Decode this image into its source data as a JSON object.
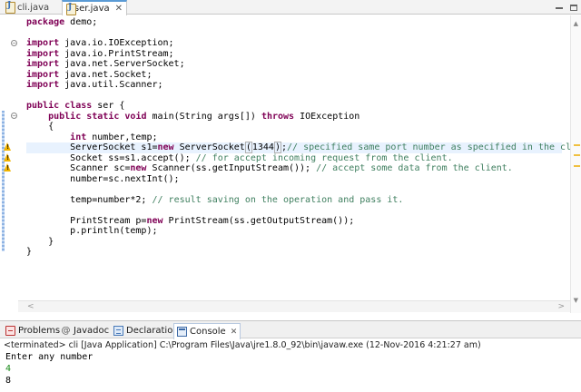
{
  "editor_tabs": [
    {
      "label": "cli.java",
      "active": false
    },
    {
      "label": "ser.java",
      "active": true
    }
  ],
  "code_lines": [
    {
      "tokens": [
        {
          "t": "package",
          "c": "kw"
        },
        {
          "t": " demo;",
          "c": ""
        }
      ]
    },
    {
      "tokens": []
    },
    {
      "tokens": [
        {
          "t": "import",
          "c": "kw"
        },
        {
          "t": " java.io.IOException;",
          "c": ""
        }
      ]
    },
    {
      "tokens": [
        {
          "t": "import",
          "c": "kw"
        },
        {
          "t": " java.io.PrintStream;",
          "c": ""
        }
      ]
    },
    {
      "tokens": [
        {
          "t": "import",
          "c": "kw"
        },
        {
          "t": " java.net.ServerSocket;",
          "c": ""
        }
      ]
    },
    {
      "tokens": [
        {
          "t": "import",
          "c": "kw"
        },
        {
          "t": " java.net.Socket;",
          "c": ""
        }
      ]
    },
    {
      "tokens": [
        {
          "t": "import",
          "c": "kw"
        },
        {
          "t": " java.util.Scanner;",
          "c": ""
        }
      ]
    },
    {
      "tokens": []
    },
    {
      "tokens": [
        {
          "t": "public",
          "c": "kw"
        },
        {
          "t": " ",
          "c": ""
        },
        {
          "t": "class",
          "c": "kw"
        },
        {
          "t": " ser {",
          "c": ""
        }
      ]
    },
    {
      "tokens": [
        {
          "t": "    ",
          "c": ""
        },
        {
          "t": "public",
          "c": "kw"
        },
        {
          "t": " ",
          "c": ""
        },
        {
          "t": "static",
          "c": "kw"
        },
        {
          "t": " ",
          "c": ""
        },
        {
          "t": "void",
          "c": "kw"
        },
        {
          "t": " main(String args[]) ",
          "c": ""
        },
        {
          "t": "throws",
          "c": "kw"
        },
        {
          "t": " IOException",
          "c": ""
        }
      ]
    },
    {
      "tokens": [
        {
          "t": "    {",
          "c": ""
        }
      ]
    },
    {
      "tokens": [
        {
          "t": "        ",
          "c": ""
        },
        {
          "t": "int",
          "c": "kw"
        },
        {
          "t": " number,temp;",
          "c": ""
        }
      ]
    },
    {
      "tokens": [
        {
          "t": "        ServerSocket s1=",
          "c": ""
        },
        {
          "t": "new",
          "c": "kw"
        },
        {
          "t": " ServerSocket",
          "c": ""
        },
        {
          "t": "(",
          "c": "bm"
        },
        {
          "t": "1344",
          "c": ""
        },
        {
          "t": ")",
          "c": "bm"
        },
        {
          "t": ";",
          "c": ""
        },
        {
          "t": "// specified same port number as specified in the client",
          "c": "cm"
        }
      ],
      "highlight": true
    },
    {
      "tokens": [
        {
          "t": "        Socket ss=s1.accept(); ",
          "c": ""
        },
        {
          "t": "// for accept incoming request from the client.",
          "c": "cm"
        }
      ]
    },
    {
      "tokens": [
        {
          "t": "        Scanner sc=",
          "c": ""
        },
        {
          "t": "new",
          "c": "kw"
        },
        {
          "t": " Scanner(ss.getInputStream()); ",
          "c": ""
        },
        {
          "t": "// accept some data from the client.",
          "c": "cm"
        }
      ]
    },
    {
      "tokens": [
        {
          "t": "        number=sc.nextInt();",
          "c": ""
        }
      ]
    },
    {
      "tokens": []
    },
    {
      "tokens": [
        {
          "t": "        temp=number*2; ",
          "c": ""
        },
        {
          "t": "// result saving on the operation and pass it.",
          "c": "cm"
        }
      ]
    },
    {
      "tokens": []
    },
    {
      "tokens": [
        {
          "t": "        PrintStream p=",
          "c": ""
        },
        {
          "t": "new",
          "c": "kw"
        },
        {
          "t": " PrintStream(ss.getOutputStream());",
          "c": ""
        }
      ]
    },
    {
      "tokens": [
        {
          "t": "        p.println(temp);",
          "c": ""
        }
      ]
    },
    {
      "tokens": [
        {
          "t": "    }",
          "c": ""
        }
      ]
    },
    {
      "tokens": [
        {
          "t": "}",
          "c": ""
        }
      ]
    }
  ],
  "view_tabs": [
    {
      "label": "Problems",
      "icon": "problems-icon",
      "active": false
    },
    {
      "label": "Javadoc",
      "icon": "javadoc-icon",
      "active": false
    },
    {
      "label": "Declaration",
      "icon": "declaration-icon",
      "active": false
    },
    {
      "label": "Console",
      "icon": "console-icon",
      "active": true
    }
  ],
  "console": {
    "terminated_text": "<terminated> cli [Java Application] C:\\Program Files\\Java\\jre1.8.0_92\\bin\\javaw.exe (12-Nov-2016 4:21:27 am)",
    "lines": [
      {
        "text": "Enter any number",
        "kind": "output"
      },
      {
        "text": "4",
        "kind": "input"
      },
      {
        "text": "8",
        "kind": "output"
      }
    ]
  },
  "colors": {
    "keyword": "#7f0055",
    "comment": "#3f7f5f",
    "console_input": "#1a8a1a",
    "current_line": "#e8f2fe"
  }
}
